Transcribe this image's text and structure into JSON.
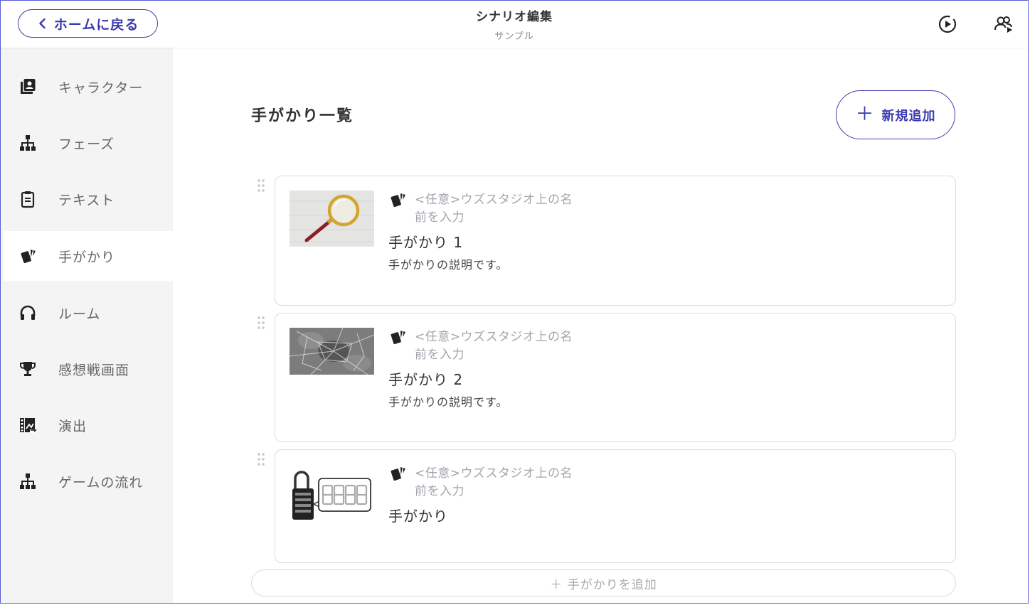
{
  "header": {
    "back_label": "ホームに戻る",
    "title": "シナリオ編集",
    "subtitle": "サンプル",
    "icons": [
      "play-circle-icon",
      "users-icon"
    ]
  },
  "sidebar": {
    "items": [
      {
        "label": "キャラクター",
        "icon": "portrait-icon",
        "active": false
      },
      {
        "label": "フェーズ",
        "icon": "sitemap-icon",
        "active": false
      },
      {
        "label": "テキスト",
        "icon": "clipboard-icon",
        "active": false
      },
      {
        "label": "手がかり",
        "icon": "cards-icon",
        "active": true
      },
      {
        "label": "ルーム",
        "icon": "headphones-icon",
        "active": false
      },
      {
        "label": "感想戦画面",
        "icon": "trophy-icon",
        "active": false
      },
      {
        "label": "演出",
        "icon": "film-icon",
        "active": false
      },
      {
        "label": "ゲームの流れ",
        "icon": "sitemap-icon",
        "active": false
      }
    ]
  },
  "main": {
    "title": "手がかり一覧",
    "add_new_label": "新規追加",
    "name_placeholder": "<任意>ウズスタジオ上の名前を入力",
    "clues": [
      {
        "name": "手がかり 1",
        "description": "手がかりの説明です。",
        "image": "magnifying-glass"
      },
      {
        "name": "手がかり 2",
        "description": "手がかりの説明です。",
        "image": "cracked-glass"
      },
      {
        "name": "手がかり",
        "description": "",
        "image": "padlock-code"
      }
    ],
    "add_clue_label": "＋ 手がかりを追加"
  },
  "colors": {
    "accent": "#3b3bb0",
    "sidebar_bg": "#f4f4f4",
    "placeholder": "#a4a4ad"
  }
}
